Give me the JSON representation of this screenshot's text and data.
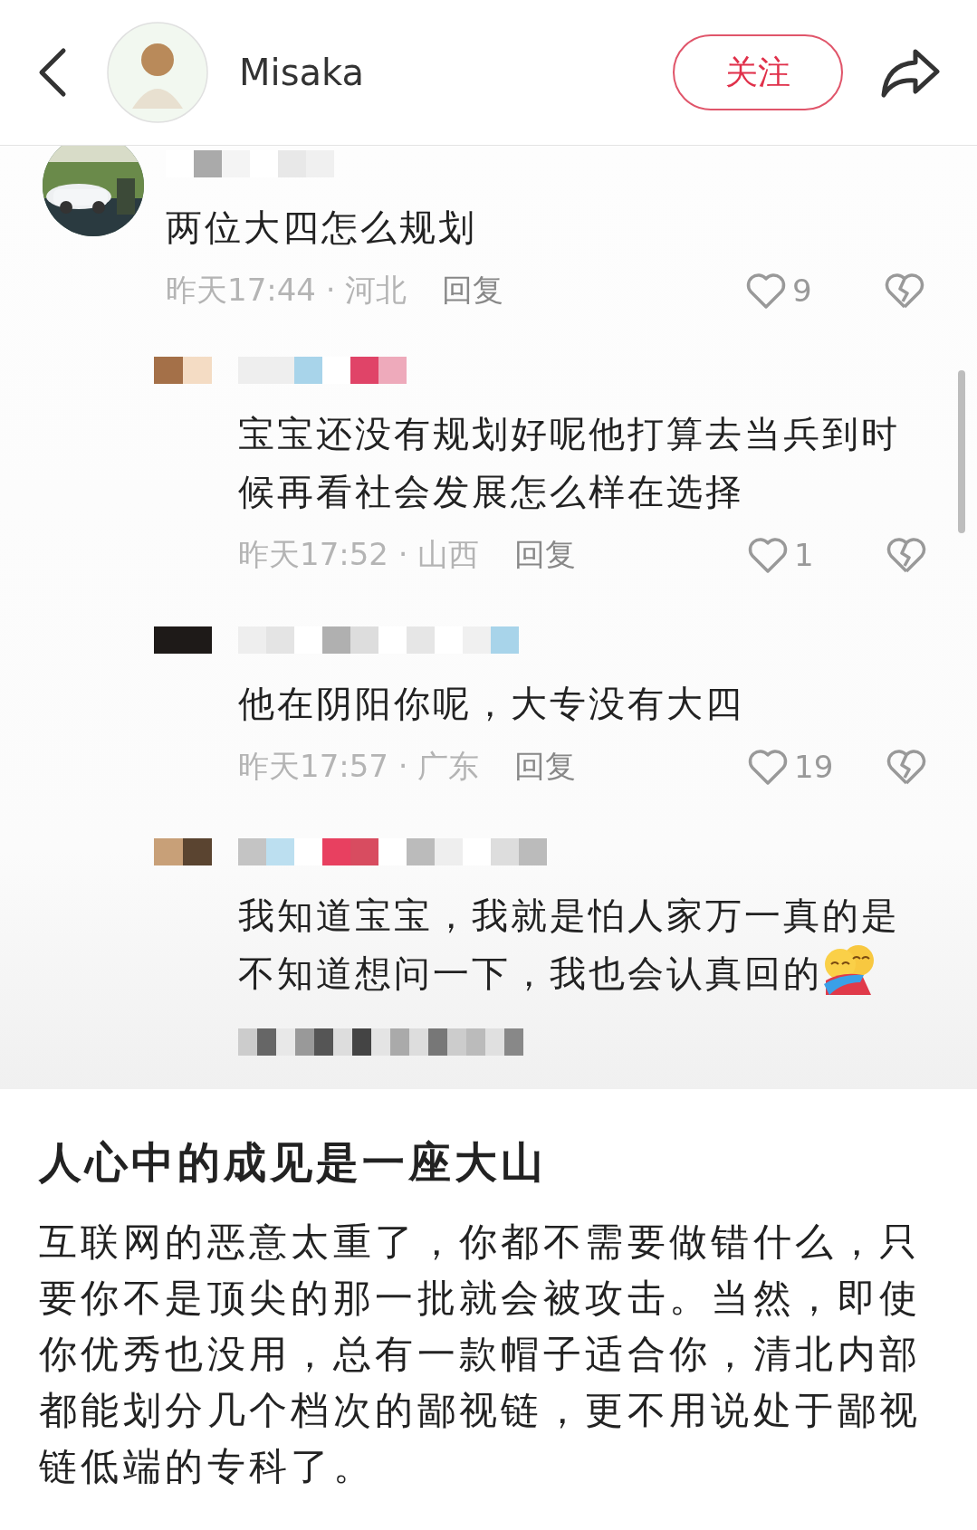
{
  "header": {
    "username": "Misaka",
    "follow_button": "关注"
  },
  "comments": [
    {
      "kind": "comment",
      "text": "两位大四怎么规划",
      "meta": "昨天17:44 · 河北",
      "reply": "回复",
      "likes": "9"
    },
    {
      "kind": "reply",
      "text": "宝宝还没有规划好呢他打算去当兵到时候再看社会发展怎么样在选择",
      "meta": "昨天17:52 · 山西",
      "reply": "回复",
      "likes": "1"
    },
    {
      "kind": "reply",
      "text": "他在阴阳你呢，大专没有大四",
      "meta": "昨天17:57 · 广东",
      "reply": "回复",
      "likes": "19"
    },
    {
      "kind": "reply",
      "text": "我知道宝宝，我就是怕人家万一真的是不知道想问一下，我也会认真回的",
      "emoji": true
    }
  ],
  "post": {
    "title": "人心中的成见是一座大山",
    "body": "互联网的恶意太重了，你都不需要做错什么，只要你不是顶尖的那一批就会被攻击。当然，即使你优秀也没用，总有一款帽子适合你，清北内部都能划分几个档次的鄙视链，更不用说处于鄙视链低端的专科了。"
  }
}
